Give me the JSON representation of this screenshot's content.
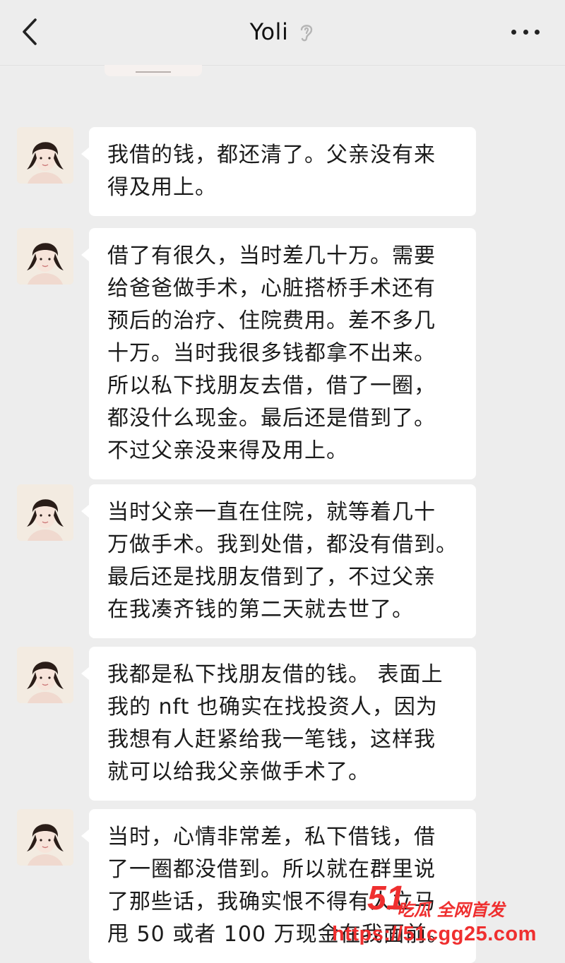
{
  "header": {
    "title": "Yoli",
    "back_icon": "chevron-left-icon",
    "mute_icon": "ear-icon",
    "more_icon": "ellipsis-icon"
  },
  "messages": [
    {
      "lines": [
        "我借的钱，都还清了。父亲没有来",
        "得及用上。"
      ]
    },
    {
      "lines": [
        "借了有很久，当时差几十万。需要",
        "给爸爸做手术，心脏搭桥手术还有",
        "预后的治疗、住院费用。差不多几",
        "十万。当时我很多钱都拿不出来。",
        "所以私下找朋友去借，借了一圈，",
        "都没什么现金。最后还是借到了。",
        "不过父亲没来得及用上。"
      ]
    },
    {
      "lines": [
        "当时父亲一直在住院，就等着几十",
        "万做手术。我到处借，都没有借到。",
        "最后还是找朋友借到了，不过父亲",
        "在我凑齐钱的第二天就去世了。"
      ]
    },
    {
      "lines": [
        "我都是私下找朋友借的钱。 表面上",
        "我的 nft 也确实在找投资人，因为",
        "我想有人赶紧给我一笔钱，这样我",
        "就可以给我父亲做手术了。"
      ]
    },
    {
      "lines": [
        "当时，心情非常差，私下借钱，借",
        "了一圈都没借到。所以就在群里说",
        "了那些话，我确实恨不得有人立马",
        "甩 50 或者 100 万现金在我面前。"
      ]
    }
  ],
  "watermark": {
    "number": "51",
    "title": "吃瓜 全网首发",
    "url": "https://51cgg25.com"
  }
}
